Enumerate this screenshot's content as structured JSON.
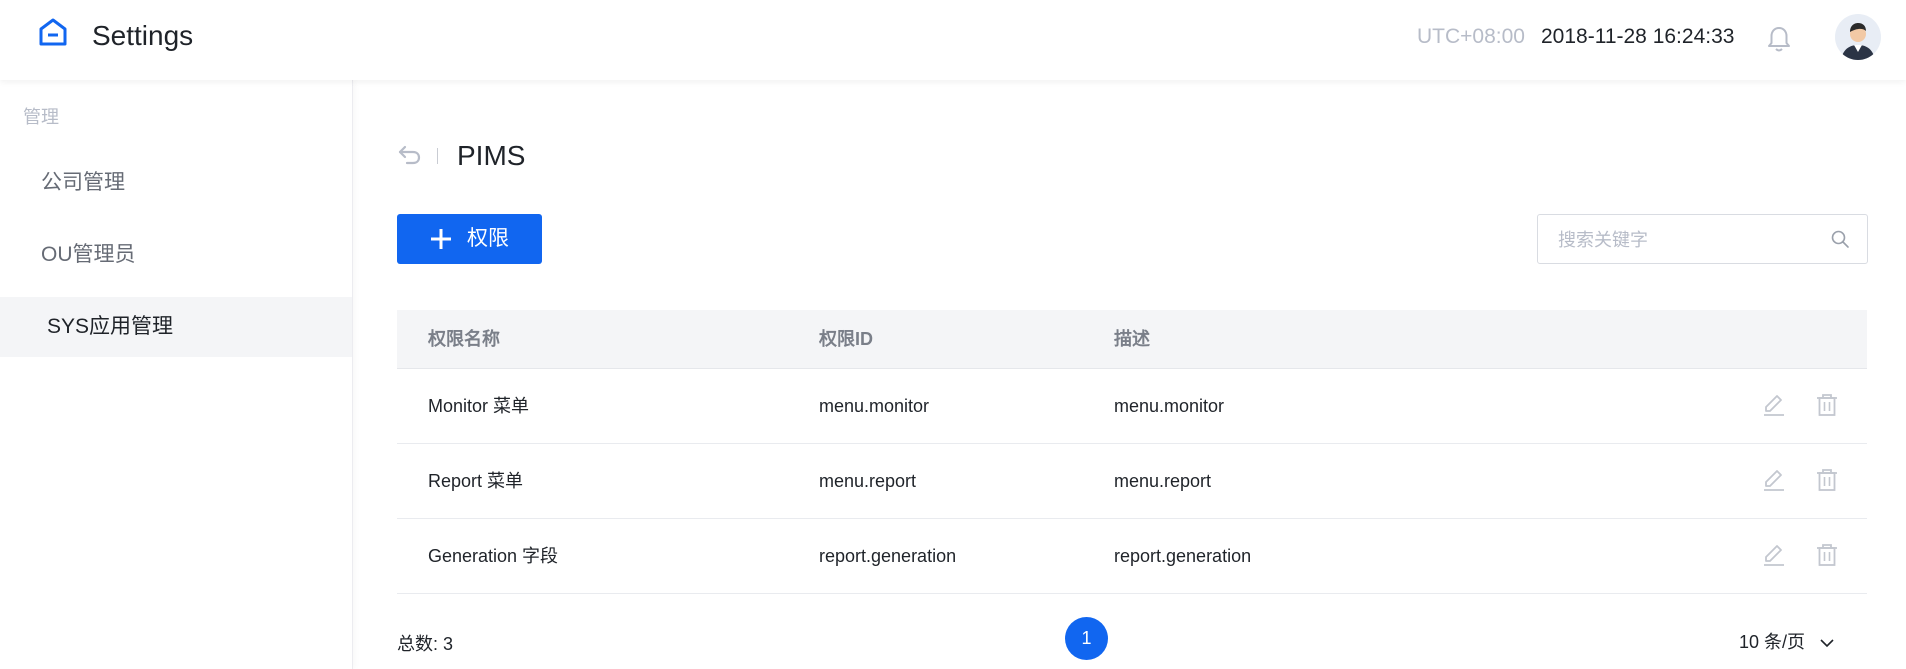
{
  "header": {
    "title": "Settings",
    "logo_icon": "home-icon",
    "timezone": "UTC+08:00",
    "datetime": "2018-11-28 16:24:33",
    "bell_icon": "bell-icon",
    "avatar_icon": "avatar"
  },
  "sidebar": {
    "group_label": "管理",
    "items": [
      {
        "label": "公司管理",
        "active": false
      },
      {
        "label": "OU管理员",
        "active": false
      },
      {
        "label": "SYS应用管理",
        "active": true
      }
    ]
  },
  "main": {
    "page_title": "PIMS",
    "add_button": {
      "label": "权限",
      "icon": "plus-icon"
    },
    "search": {
      "placeholder": "搜索关键字",
      "value": "",
      "icon": "search-icon"
    },
    "table": {
      "columns": [
        "权限名称",
        "权限ID",
        "描述"
      ],
      "rows": [
        {
          "name": "Monitor 菜单",
          "id": "menu.monitor",
          "desc": "menu.monitor"
        },
        {
          "name": "Report 菜单",
          "id": "menu.report",
          "desc": "menu.report"
        },
        {
          "name": "Generation 字段",
          "id": "report.generation",
          "desc": "report.generation"
        }
      ],
      "row_actions": [
        "edit-icon",
        "trash-icon"
      ]
    },
    "footer": {
      "total": "总数: 3",
      "current_page": "1",
      "page_size": "10 条/页"
    }
  },
  "colors": {
    "accent": "#1166f0",
    "muted_text": "#b7bcc8",
    "table_header_bg": "#f4f5f7",
    "active_sidebar_bg": "#f4f5f7"
  }
}
